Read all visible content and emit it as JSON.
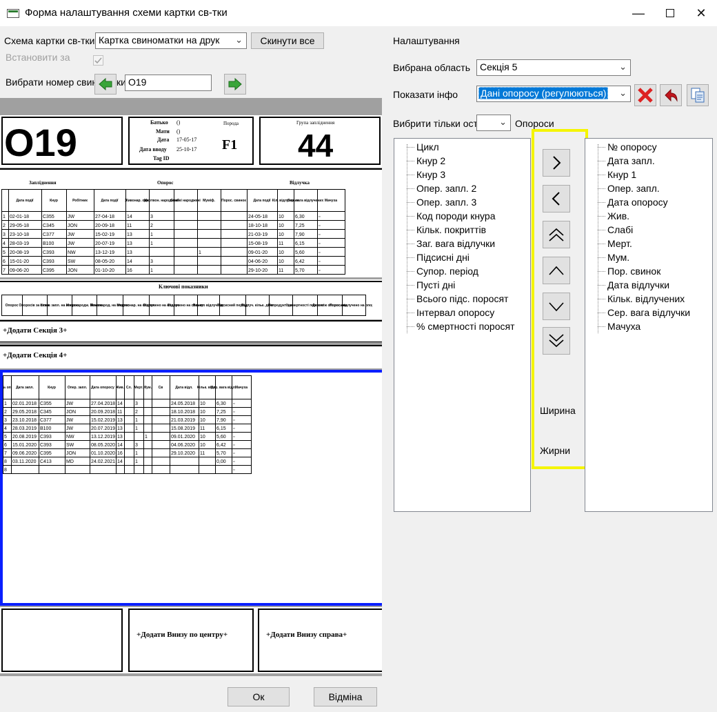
{
  "window": {
    "title": "Форма налаштування схеми картки св-тки",
    "min": "—",
    "max": "☐",
    "close": "✕"
  },
  "left": {
    "schema_label": "Схема картки св-тки",
    "schema_value": "Картка свиноматки на друк",
    "reset_label": "Скинути все",
    "set_for_label": "Встановити за",
    "choose_label": "Вибрати номер свин",
    "choose_label_tail": "ки",
    "sow_number": "O19"
  },
  "preview": {
    "big_number": "O19",
    "father_label": "Батько",
    "father_value": "()",
    "mother_label": "Мати",
    "mother_value": "()",
    "date_label": "Дата",
    "date_value": "17-05-17",
    "entry_label": "Дата вводу",
    "entry_value": "25-10-17",
    "tag_label": "Tag ID",
    "breed_label": "Порода",
    "breed_value": "F1",
    "group_label": "Група запліднення",
    "group_value": "44",
    "sec_insem": "Запліднення",
    "sec_farrow": "Опорос",
    "sec_wean": "Відлучка",
    "key_title": "Ключові показники",
    "add3": "+Додати Секція 3+",
    "add4": "+Додати Секція 4+",
    "add_bottom_center": "+Додати Внизу по центру+",
    "add_bottom_right": "+Додати Внизу справа+",
    "t1_head": [
      "Дата події",
      "Кнур",
      "Робітник",
      "Дата події",
      "Живонар. одн.",
      "Мертвон. народжені",
      "Слабкі народжені",
      "Муміф.",
      "Порос. свинок",
      "Дата події",
      "Кіл. відлучених",
      "Сер. вага відлучених",
      "Мачуха"
    ],
    "t1_rows": [
      [
        "1",
        "02-01-18",
        "C355",
        "JW",
        "27-04-18",
        "14",
        "3",
        "",
        "",
        "",
        "24-05-18",
        "10",
        "6,30",
        "▫"
      ],
      [
        "2",
        "29-05-18",
        "C345",
        "JON",
        "20-09-18",
        "11",
        "2",
        "",
        "",
        "",
        "18-10-18",
        "10",
        "7,25",
        "▫"
      ],
      [
        "3",
        "23-10-18",
        "C377",
        "JW",
        "15-02-19",
        "13",
        "1",
        "",
        "",
        "",
        "21-03-19",
        "10",
        "7,90",
        "▫"
      ],
      [
        "4",
        "28-03-19",
        "B100",
        "JW",
        "20-07-19",
        "13",
        "1",
        "",
        "",
        "",
        "15-08-19",
        "11",
        "6,15",
        "▫"
      ],
      [
        "5",
        "20-08-19",
        "C393",
        "NW",
        "13-12-19",
        "13",
        "",
        "",
        "1",
        "",
        "09-01-20",
        "10",
        "5,60",
        "▫"
      ],
      [
        "6",
        "15-01-20",
        "C393",
        "SW",
        "08-05-20",
        "14",
        "3",
        "",
        "",
        "",
        "04-06-20",
        "10",
        "6,42",
        "▫"
      ],
      [
        "7",
        "09-06-20",
        "C395",
        "JON",
        "01-10-20",
        "16",
        "1",
        "",
        "",
        "",
        "29-10-20",
        "11",
        "5,70",
        "▫"
      ]
    ],
    "key_head": [
      "Опорос",
      "Опоросів за сезон",
      "Кільк. запл. на опорос",
      "Живонародж. Всього",
      "Живонарод. на опорос",
      "Мертвонар. на опорос",
      "Відлучено на опорос",
      "Відлучено на свинку",
      "Всього відлучено",
      "Підсисний період",
      "Відлуч. кільк. днів",
      "Непродукт. дні",
      "% смертності поросят",
      "Днів між опоросами",
      "Порос. відлучено на опорос"
    ],
    "t2_head": [
      "№ оп.",
      "Дата запл.",
      "Кнур",
      "Опер. запл.",
      "Дата опоросу",
      "Жив.",
      "Сл.",
      "Мерт.",
      "Мум.",
      "Св",
      "Дата відл.",
      "Кільк. відл.",
      "Сер. вага відл.",
      "Мачуха"
    ],
    "t2_rows": [
      [
        "1",
        "02.01.2018",
        "C355",
        "JW",
        "27.04.2018",
        "14",
        "",
        "3",
        "",
        "",
        "24.05.2018",
        "10",
        "6,30",
        "▫"
      ],
      [
        "2",
        "29.05.2018",
        "C345",
        "JON",
        "20.09.2018",
        "11",
        "",
        "2",
        "",
        "",
        "18.10.2018",
        "10",
        "7,25",
        "▫"
      ],
      [
        "3",
        "23.10.2018",
        "C377",
        "JW",
        "15.02.2019",
        "13",
        "",
        "1",
        "",
        "",
        "21.03.2019",
        "10",
        "7,90",
        "▫"
      ],
      [
        "4",
        "28.03.2019",
        "B100",
        "JW",
        "20.07.2019",
        "13",
        "",
        "1",
        "",
        "",
        "15.08.2019",
        "11",
        "6,15",
        "▫"
      ],
      [
        "5",
        "20.08.2019",
        "C393",
        "NW",
        "13.12.2019",
        "13",
        "",
        "",
        "1",
        "",
        "09.01.2020",
        "10",
        "5,60",
        "▫"
      ],
      [
        "6",
        "15.01.2020",
        "C393",
        "SW",
        "08.05.2020",
        "14",
        "",
        "3",
        "",
        "",
        "04.06.2020",
        "10",
        "6,42",
        "▫"
      ],
      [
        "7",
        "09.06.2020",
        "C395",
        "JON",
        "01.10.2020",
        "16",
        "",
        "1",
        "",
        "",
        "29.10.2020",
        "11",
        "5,70",
        "▫"
      ],
      [
        "8",
        "03.11.2020",
        "C413",
        "MD",
        "24.02.2021",
        "14",
        "",
        "1",
        "",
        "",
        "",
        "",
        "0,00",
        "▫"
      ],
      [
        "8",
        "",
        "",
        "",
        "",
        "",
        "",
        "",
        "",
        "",
        "",
        "",
        "",
        "▫"
      ]
    ]
  },
  "right": {
    "settings_label": "Налаштування",
    "area_label": "Вибрана область",
    "area_value": "Секція 5",
    "info_label": "Показати інфо",
    "info_value": "Дані опоросу (регулюються)",
    "filter_label": "Вибрити тільки оста",
    "filter_tail": "Опороси",
    "available": [
      "Цикл",
      "Кнур 2",
      "Кнур 3",
      "Опер. запл. 2",
      "Опер. запл. 3",
      "Код породи кнура",
      "Кільк. покриттів",
      "Заг. вага відлучки",
      "Підсисні дні",
      "Супор. період",
      "Пусті дні",
      "Всього підс. поросят",
      "Інтервал опоросу",
      "% смертності поросят"
    ],
    "selected": [
      "№ опоросу",
      "Дата запл.",
      "Кнур 1",
      "Опер. запл.",
      "Дата опоросу",
      "Жив.",
      "Слабі",
      "Мерт.",
      "Мум.",
      "Пор. свинок",
      "Дата відлучки",
      "Кільк. відлучених",
      "Сер. вага відлучки",
      "Мачуха"
    ],
    "width_label": "Ширина",
    "bold_label": "Жирни",
    "highlight_color": "#f5f500"
  },
  "footer": {
    "ok": "Ок",
    "cancel": "Відміна"
  }
}
